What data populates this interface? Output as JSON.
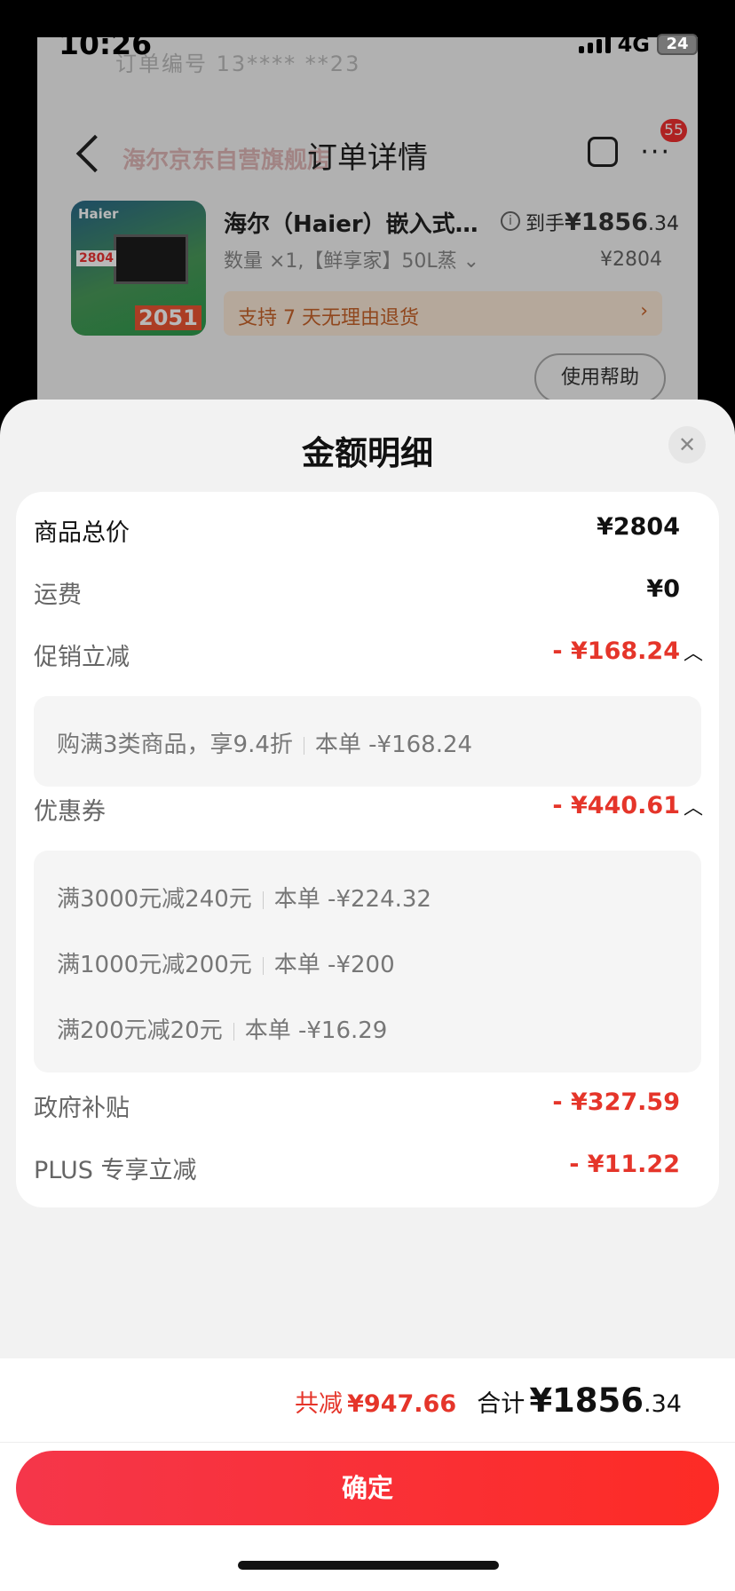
{
  "status_bar": {
    "time": "10:26",
    "network": "4G",
    "battery": "24"
  },
  "background": {
    "blur_text": "订单编号 13**** **23",
    "store_name": "海尔京东自营旗舰店",
    "nav_title": "订单详情",
    "badge_count": "55",
    "product": {
      "name": "海尔（Haier）嵌入式…",
      "spec": "数量 ×1,【鲜享家】50L蒸",
      "daoshou_label": "到手",
      "daoshou_price_int": "¥1856",
      "daoshou_price_dec": ".34",
      "original_price": "¥2804",
      "thumb_brand": "Haier",
      "thumb_price_1": "2804",
      "thumb_price_2": "2051"
    },
    "return_policy": "支持 7 天无理由退货",
    "help_button": "使用帮助"
  },
  "sheet": {
    "title": "金额明细",
    "rows": {
      "goods_total": {
        "label": "商品总价",
        "value": "¥2804"
      },
      "shipping": {
        "label": "运费",
        "value": "¥0"
      },
      "promo": {
        "label": "促销立减",
        "value": "- ¥168.24"
      },
      "coupon": {
        "label": "优惠券",
        "value": "- ¥440.61"
      },
      "gov_subsidy": {
        "label": "政府补贴",
        "value": "- ¥327.59"
      },
      "plus": {
        "label": "PLUS 专享立减",
        "value": "- ¥11.22"
      }
    },
    "promo_details": [
      {
        "desc": "购满3类商品，享9.4折",
        "amount": "本单 -¥168.24"
      }
    ],
    "coupon_details": [
      {
        "desc": "满3000元减240元",
        "amount": "本单 -¥224.32"
      },
      {
        "desc": "满1000元减200元",
        "amount": "本单 -¥200"
      },
      {
        "desc": "满200元减20元",
        "amount": "本单 -¥16.29"
      }
    ]
  },
  "footer": {
    "saved_label": "共减",
    "saved_value": "¥947.66",
    "total_label": "合计",
    "total_int": "¥1856",
    "total_dec": ".34",
    "confirm": "确定"
  },
  "colors": {
    "accent_red": "#e5352a",
    "button_gradient_start": "#f5364a",
    "button_gradient_end": "#fd2b25"
  }
}
